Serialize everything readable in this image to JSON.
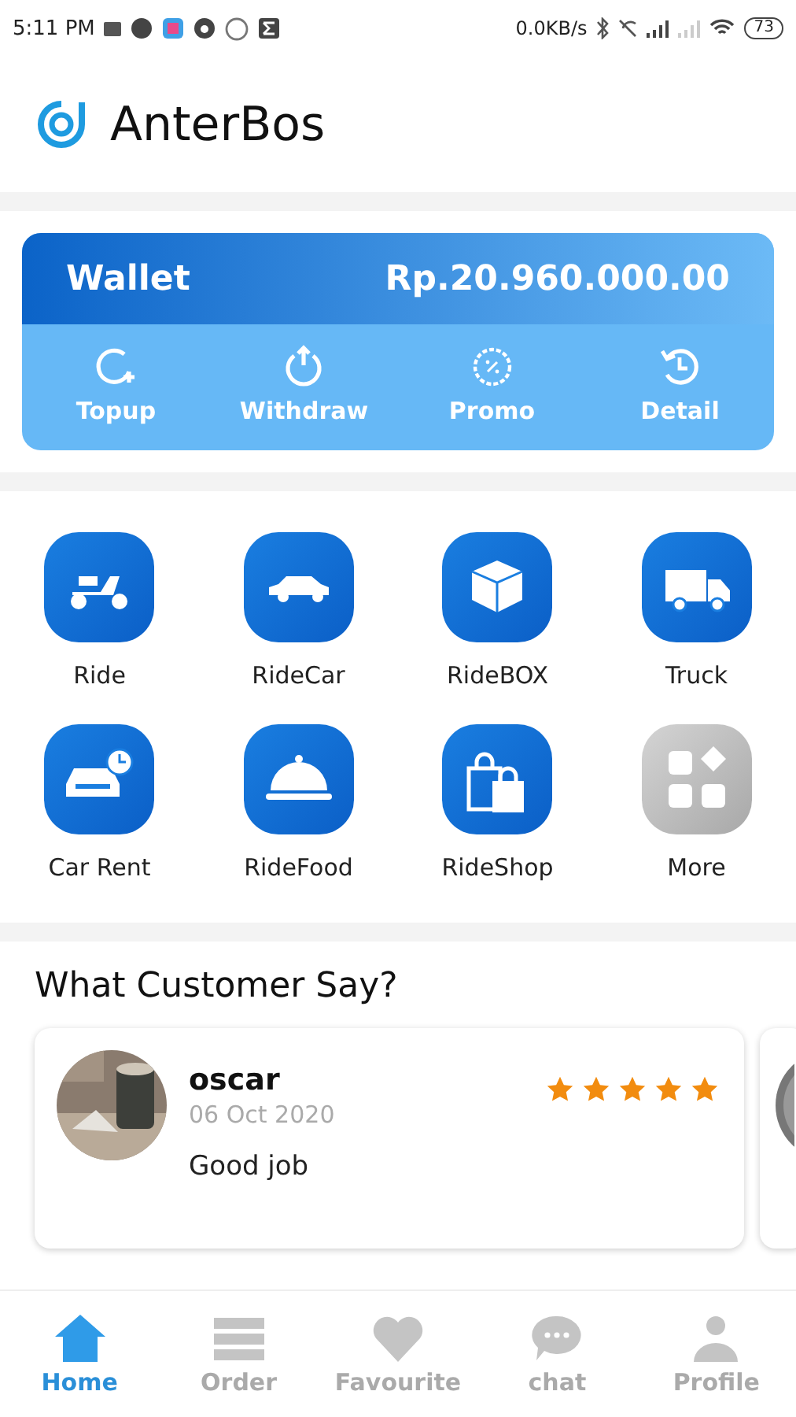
{
  "status_bar": {
    "time": "5:11 PM",
    "network_speed": "0.0KB/s",
    "battery": "73"
  },
  "header": {
    "title": "AnterBos"
  },
  "wallet": {
    "title": "Wallet",
    "balance": "Rp.20.960.000.00",
    "actions": [
      {
        "kind": "topup",
        "label": "Topup"
      },
      {
        "kind": "withdraw",
        "label": "Withdraw"
      },
      {
        "kind": "promo",
        "label": "Promo"
      },
      {
        "kind": "detail",
        "label": "Detail"
      }
    ]
  },
  "services": [
    {
      "kind": "ride",
      "label": "Ride"
    },
    {
      "kind": "car",
      "label": "RideCar"
    },
    {
      "kind": "box",
      "label": "RideBOX"
    },
    {
      "kind": "truck",
      "label": "Truck"
    },
    {
      "kind": "rent",
      "label": "Car Rent"
    },
    {
      "kind": "food",
      "label": "RideFood"
    },
    {
      "kind": "shop",
      "label": "RideShop"
    },
    {
      "kind": "more",
      "label": "More"
    }
  ],
  "testimonials": {
    "title": "What Customer Say?",
    "reviews": [
      {
        "name": "oscar",
        "date": "06 Oct 2020",
        "stars": 5,
        "text": "Good job"
      }
    ]
  },
  "bottom_nav": [
    {
      "kind": "home",
      "label": "Home",
      "selected": true
    },
    {
      "kind": "order",
      "label": "Order",
      "selected": false
    },
    {
      "kind": "favourite",
      "label": "Favourite",
      "selected": false
    },
    {
      "kind": "chat",
      "label": "chat",
      "selected": false
    },
    {
      "kind": "profile",
      "label": "Profile",
      "selected": false
    }
  ]
}
